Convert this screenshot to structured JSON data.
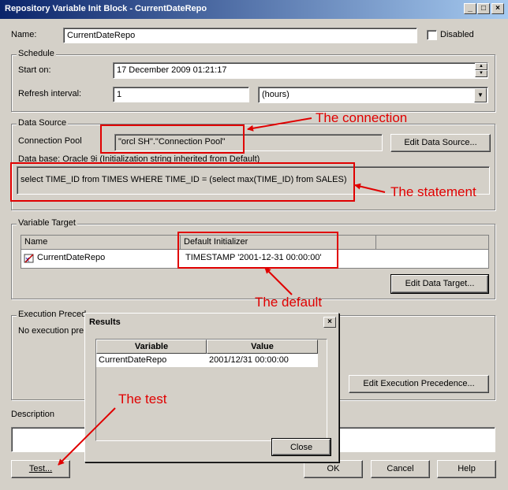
{
  "window": {
    "title": "Repository Variable Init Block - CurrentDateRepo"
  },
  "name": {
    "label": "Name:",
    "value": "CurrentDateRepo"
  },
  "disabled": {
    "label": "Disabled"
  },
  "schedule": {
    "group_label": "Schedule",
    "start_label": "Start on:",
    "start_value": "17  December  2009 01:21:17",
    "refresh_label": "Refresh interval:",
    "refresh_value": "1",
    "unit_value": "(hours)"
  },
  "data_source": {
    "group_label": "Data Source",
    "pool_label": "Connection Pool",
    "pool_value": "\"orcl SH\".\"Connection Pool\"",
    "edit_button": "Edit Data Source...",
    "db_note": "Data base: Oracle 9i (Initialization string inherited from Default)",
    "sql": "select TIME_ID  from TIMES WHERE TIME_ID = (select max(TIME_ID) from SALES)"
  },
  "variable_target": {
    "group_label": "Variable Target",
    "col_name": "Name",
    "col_default": "Default Initializer",
    "row_name": "CurrentDateRepo",
    "row_default": "TIMESTAMP '2001-12-31 00:00:00'",
    "edit_button": "Edit Data Target..."
  },
  "execution": {
    "group_label": "Execution Preced",
    "text": "No execution pre",
    "edit_button": "Edit Execution Precedence..."
  },
  "description": {
    "label": "Description"
  },
  "buttons": {
    "test": "Test...",
    "ok": "OK",
    "cancel": "Cancel",
    "help": "Help"
  },
  "results_dialog": {
    "title": "Results",
    "col_variable": "Variable",
    "col_value": "Value",
    "row_variable": "CurrentDateRepo",
    "row_value": "2001/12/31 00:00:00",
    "close_button": "Close"
  },
  "annotations": {
    "connection": "The connection",
    "statement": "The statement",
    "default": "The default",
    "test": "The test"
  },
  "colors": {
    "annotation": "#e00000",
    "titlebar": "#0a246a"
  }
}
